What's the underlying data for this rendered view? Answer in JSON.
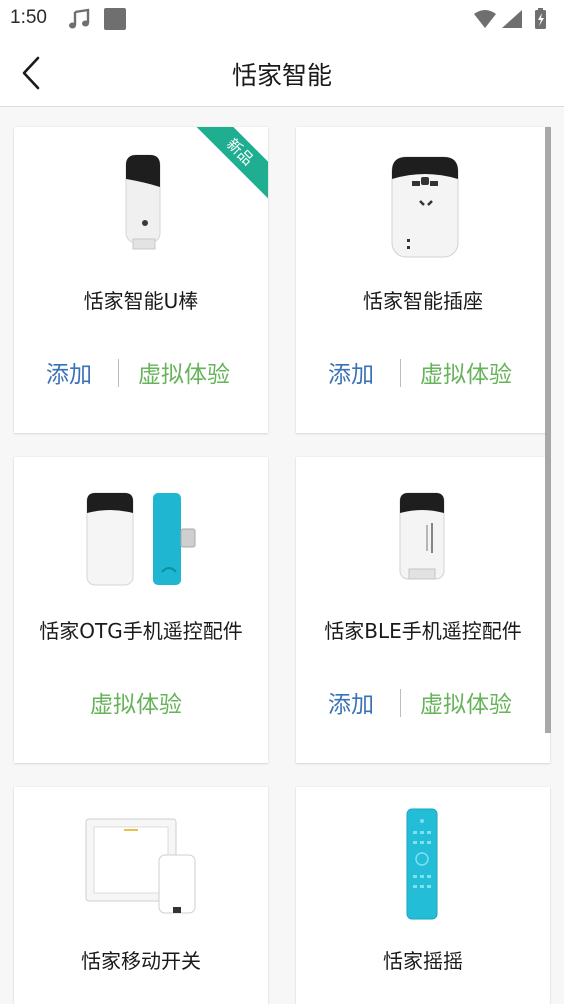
{
  "status_bar": {
    "time": "1:50"
  },
  "header": {
    "title": "恬家智能"
  },
  "products": [
    {
      "name": "恬家智能U棒",
      "add": "添加",
      "try": "虚拟体验",
      "badge": "新品"
    },
    {
      "name": "恬家智能插座",
      "add": "添加",
      "try": "虚拟体验"
    },
    {
      "name": "恬家OTG手机遥控配件",
      "try": "虚拟体验"
    },
    {
      "name": "恬家BLE手机遥控配件",
      "add": "添加",
      "try": "虚拟体验"
    },
    {
      "name": "恬家移动开关"
    },
    {
      "name": "恬家摇摇"
    }
  ],
  "colors": {
    "add": "#3a72b8",
    "try": "#66b35a",
    "badge": "#1fae8f"
  }
}
